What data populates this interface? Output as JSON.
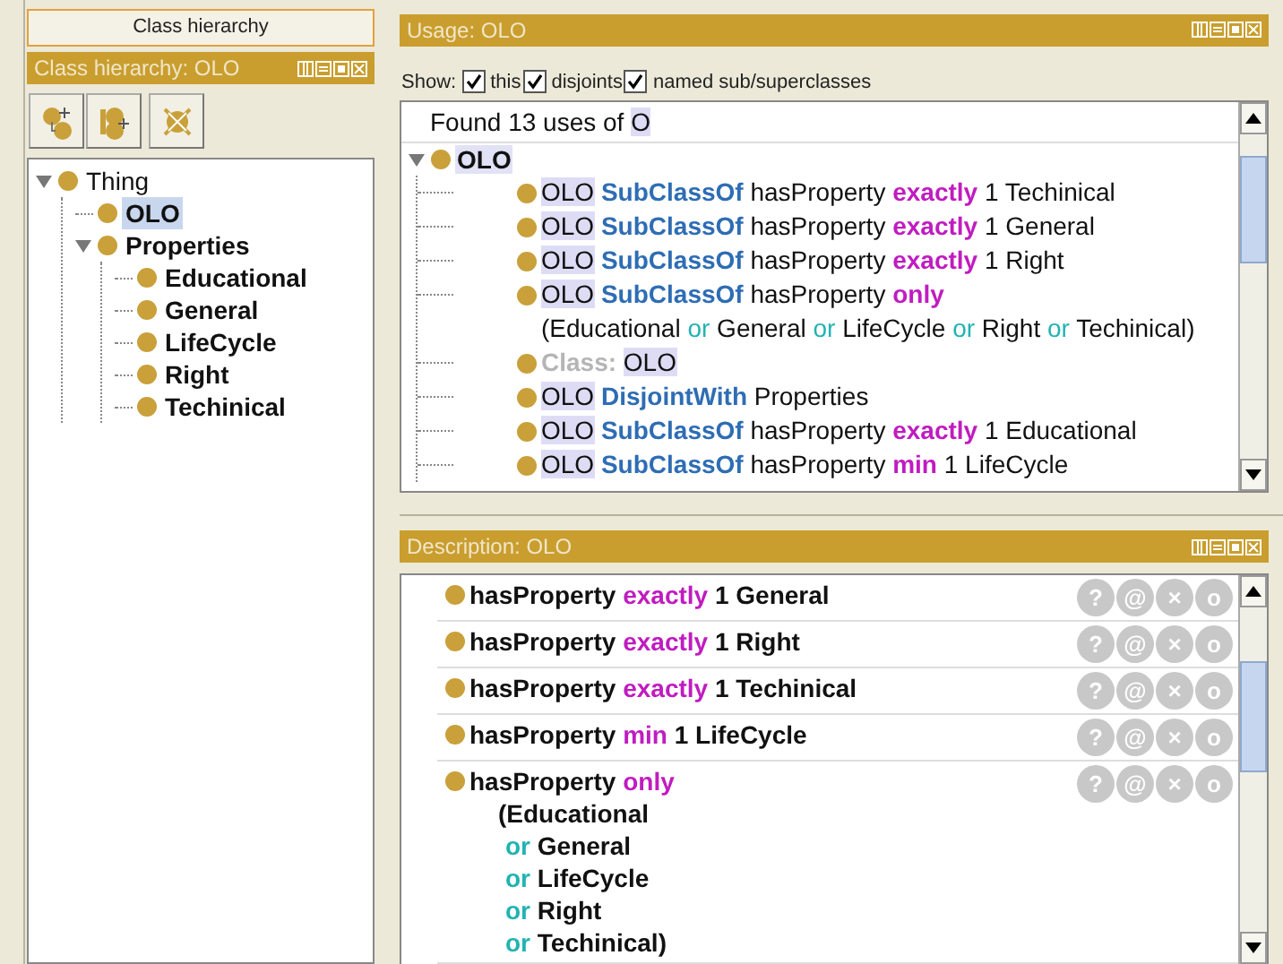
{
  "left_tab": {
    "label": "Class hierarchy"
  },
  "hierarchy_panel": {
    "title": "Class hierarchy: OLO",
    "tree": [
      {
        "label": "Thing",
        "bold": false,
        "selected": false,
        "expanded": true,
        "children": [
          {
            "label": "OLO",
            "bold": true,
            "selected": true
          },
          {
            "label": "Properties",
            "bold": true,
            "selected": false,
            "expanded": true,
            "children": [
              {
                "label": "Educational",
                "bold": true,
                "selected": false
              },
              {
                "label": "General",
                "bold": true,
                "selected": false
              },
              {
                "label": "LifeCycle",
                "bold": true,
                "selected": false
              },
              {
                "label": "Right",
                "bold": true,
                "selected": false
              },
              {
                "label": "Techinical",
                "bold": true,
                "selected": false
              }
            ]
          }
        ]
      }
    ]
  },
  "usage_panel": {
    "title": "Usage: OLO",
    "show_label": "Show:",
    "show_options": [
      {
        "label": "this",
        "checked": true
      },
      {
        "label": "disjoints",
        "checked": true
      },
      {
        "label": "named sub/superclasses",
        "checked": true
      }
    ],
    "summary": [
      {
        "text": "Found 13 uses of ",
        "kind": "plain"
      },
      {
        "text": "O",
        "kind": "entity"
      }
    ],
    "root": {
      "label": "OLO",
      "expanded": true
    },
    "items": [
      {
        "lines": [
          [
            {
              "text": "OLO",
              "kind": "entity"
            },
            {
              "text": " SubClassOf",
              "kind": "keyword"
            },
            {
              "text": " hasProperty ",
              "kind": "plain"
            },
            {
              "text": "exactly",
              "kind": "restriction"
            },
            {
              "text": " 1 Techinical",
              "kind": "plain"
            }
          ]
        ]
      },
      {
        "lines": [
          [
            {
              "text": "OLO",
              "kind": "entity"
            },
            {
              "text": " SubClassOf",
              "kind": "keyword"
            },
            {
              "text": " hasProperty ",
              "kind": "plain"
            },
            {
              "text": "exactly",
              "kind": "restriction"
            },
            {
              "text": " 1 General",
              "kind": "plain"
            }
          ]
        ]
      },
      {
        "lines": [
          [
            {
              "text": "OLO",
              "kind": "entity"
            },
            {
              "text": " SubClassOf",
              "kind": "keyword"
            },
            {
              "text": " hasProperty ",
              "kind": "plain"
            },
            {
              "text": "exactly",
              "kind": "restriction"
            },
            {
              "text": " 1 Right",
              "kind": "plain"
            }
          ]
        ]
      },
      {
        "lines": [
          [
            {
              "text": "OLO",
              "kind": "entity"
            },
            {
              "text": " SubClassOf",
              "kind": "keyword"
            },
            {
              "text": " hasProperty ",
              "kind": "plain"
            },
            {
              "text": "only",
              "kind": "restriction"
            }
          ],
          [
            {
              "text": "(Educational ",
              "kind": "plain"
            },
            {
              "text": "or",
              "kind": "connective"
            },
            {
              "text": " General ",
              "kind": "plain"
            },
            {
              "text": "or",
              "kind": "connective"
            },
            {
              "text": " LifeCycle ",
              "kind": "plain"
            },
            {
              "text": "or",
              "kind": "connective"
            },
            {
              "text": " Right ",
              "kind": "plain"
            },
            {
              "text": "or",
              "kind": "connective"
            },
            {
              "text": " Techinical)",
              "kind": "plain"
            }
          ]
        ]
      },
      {
        "lines": [
          [
            {
              "text": "Class: ",
              "kind": "label"
            },
            {
              "text": "OLO",
              "kind": "entity"
            }
          ]
        ]
      },
      {
        "lines": [
          [
            {
              "text": "OLO",
              "kind": "entity"
            },
            {
              "text": " DisjointWith",
              "kind": "keyword"
            },
            {
              "text": " Properties",
              "kind": "plain"
            }
          ]
        ]
      },
      {
        "lines": [
          [
            {
              "text": "OLO",
              "kind": "entity"
            },
            {
              "text": " SubClassOf",
              "kind": "keyword"
            },
            {
              "text": " hasProperty ",
              "kind": "plain"
            },
            {
              "text": "exactly",
              "kind": "restriction"
            },
            {
              "text": " 1 Educational",
              "kind": "plain"
            }
          ]
        ]
      },
      {
        "lines": [
          [
            {
              "text": "OLO",
              "kind": "entity"
            },
            {
              "text": " SubClassOf",
              "kind": "keyword"
            },
            {
              "text": " hasProperty ",
              "kind": "plain"
            },
            {
              "text": "min",
              "kind": "restriction"
            },
            {
              "text": " 1 LifeCycle",
              "kind": "plain"
            }
          ]
        ]
      }
    ]
  },
  "description_panel": {
    "title": "Description: OLO",
    "rows": [
      {
        "lines": [
          [
            {
              "text": "hasProperty ",
              "kind": "plain"
            },
            {
              "text": "exactly",
              "kind": "restriction"
            },
            {
              "text": " 1 General",
              "kind": "plain"
            }
          ]
        ],
        "buttons": [
          "?",
          "@",
          "×",
          "o"
        ]
      },
      {
        "lines": [
          [
            {
              "text": "hasProperty ",
              "kind": "plain"
            },
            {
              "text": "exactly",
              "kind": "restriction"
            },
            {
              "text": " 1 Right",
              "kind": "plain"
            }
          ]
        ],
        "buttons": [
          "?",
          "@",
          "×",
          "o"
        ]
      },
      {
        "lines": [
          [
            {
              "text": "hasProperty ",
              "kind": "plain"
            },
            {
              "text": "exactly",
              "kind": "restriction"
            },
            {
              "text": " 1 Techinical",
              "kind": "plain"
            }
          ]
        ],
        "buttons": [
          "?",
          "@",
          "×",
          "o"
        ]
      },
      {
        "lines": [
          [
            {
              "text": "hasProperty ",
              "kind": "plain"
            },
            {
              "text": "min",
              "kind": "restriction"
            },
            {
              "text": " 1 LifeCycle",
              "kind": "plain"
            }
          ]
        ],
        "buttons": [
          "?",
          "@",
          "×",
          "o"
        ]
      },
      {
        "lines": [
          [
            {
              "text": "hasProperty ",
              "kind": "plain"
            },
            {
              "text": "only",
              "kind": "restriction"
            }
          ],
          [
            {
              "text": "(Educational",
              "kind": "plain"
            }
          ],
          [
            {
              "text": "or",
              "kind": "connective"
            },
            {
              "text": " General",
              "kind": "plain"
            }
          ],
          [
            {
              "text": "or",
              "kind": "connective"
            },
            {
              "text": " LifeCycle",
              "kind": "plain"
            }
          ],
          [
            {
              "text": "or",
              "kind": "connective"
            },
            {
              "text": " Right",
              "kind": "plain"
            }
          ],
          [
            {
              "text": "or",
              "kind": "connective"
            },
            {
              "text": " Techinical)",
              "kind": "plain"
            }
          ]
        ],
        "buttons": [
          "?",
          "@",
          "×",
          "o"
        ]
      }
    ]
  }
}
